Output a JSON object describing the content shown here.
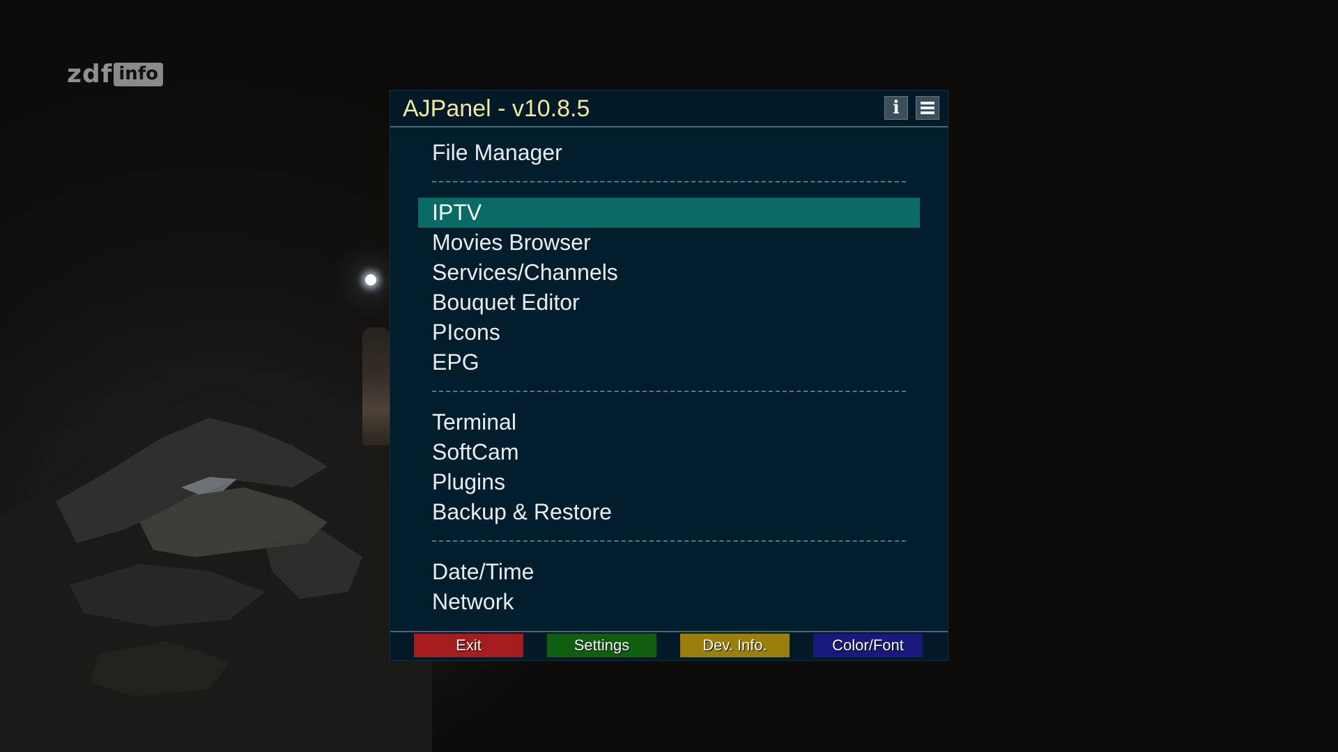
{
  "channel_logo": {
    "brand": "zdf",
    "suffix": "info"
  },
  "panel": {
    "title": "AJPanel - v10.8.5",
    "header_buttons": [
      {
        "icon": "info-icon",
        "glyph": "i"
      },
      {
        "icon": "menu-icon"
      }
    ],
    "selected_item": "IPTV",
    "items": [
      {
        "type": "item",
        "label": "File Manager"
      },
      {
        "type": "separator"
      },
      {
        "type": "item",
        "label": "IPTV",
        "selected": true
      },
      {
        "type": "item",
        "label": "Movies Browser"
      },
      {
        "type": "item",
        "label": "Services/Channels"
      },
      {
        "type": "item",
        "label": "Bouquet Editor"
      },
      {
        "type": "item",
        "label": "PIcons"
      },
      {
        "type": "item",
        "label": "EPG"
      },
      {
        "type": "separator"
      },
      {
        "type": "item",
        "label": "Terminal"
      },
      {
        "type": "item",
        "label": "SoftCam"
      },
      {
        "type": "item",
        "label": "Plugins"
      },
      {
        "type": "item",
        "label": "Backup & Restore"
      },
      {
        "type": "separator"
      },
      {
        "type": "item",
        "label": "Date/Time"
      },
      {
        "type": "item",
        "label": "Network"
      }
    ]
  },
  "footer": {
    "buttons": [
      {
        "label": "Exit",
        "color": "red",
        "hex": "#a41c1c"
      },
      {
        "label": "Settings",
        "color": "green",
        "hex": "#0f5e12"
      },
      {
        "label": "Dev. Info.",
        "color": "yellow",
        "hex": "#9a7f0c"
      },
      {
        "label": "Color/Font",
        "color": "blue",
        "hex": "#19197c"
      }
    ]
  },
  "colors": {
    "title_text": "#f2e79a",
    "panel_bg": "#021e2d",
    "selection_bg": "#0a6b66",
    "item_text": "#e9edef"
  }
}
